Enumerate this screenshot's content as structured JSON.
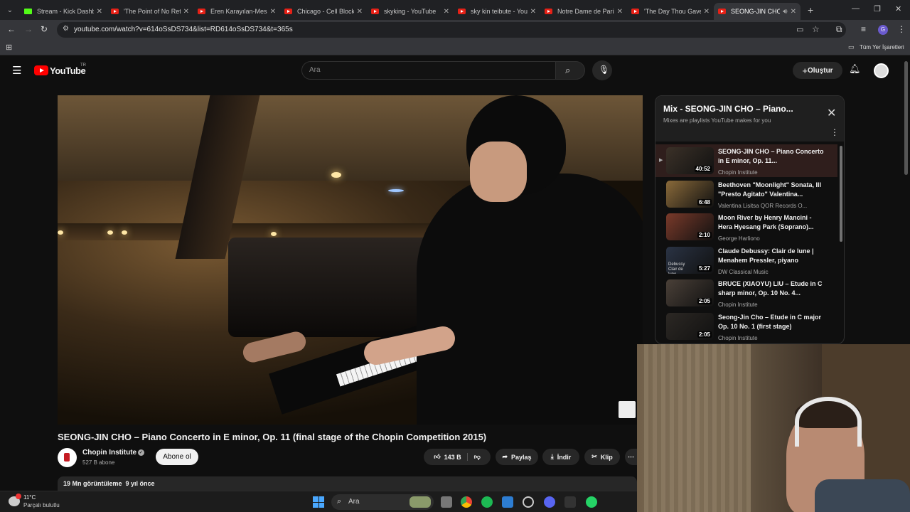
{
  "browser": {
    "tabs": [
      {
        "label": "Stream - Kick Dashboard",
        "kind": "kick"
      },
      {
        "label": "'The Point of No Return'",
        "kind": "yt"
      },
      {
        "label": "Eren Karayılan-Mesaj",
        "kind": "yt"
      },
      {
        "label": "Chicago - Cell Block Tango",
        "kind": "yt"
      },
      {
        "label": "skyking - YouTube",
        "kind": "yt"
      },
      {
        "label": "sky kin teibute - YouTube",
        "kind": "yt"
      },
      {
        "label": "Notre Dame de Paris",
        "kind": "yt"
      },
      {
        "label": "'The Day Thou Gavest'",
        "kind": "yt"
      },
      {
        "label": "SEONG-JIN CHO",
        "kind": "yt",
        "active": true
      }
    ],
    "url": "youtube.com/watch?v=614oSsDS734&list=RD614oSsDS734&t=365s",
    "bookmarks_folder": "Tüm Yer İşaretleri",
    "profile_initial": "G"
  },
  "youtube": {
    "logo_text": "YouTube",
    "region": "TR",
    "search_placeholder": "Ara",
    "create_label": "Oluştur"
  },
  "video": {
    "title": "SEONG-JIN CHO – Piano Concerto in E minor, Op. 11 (final stage of the Chopin Competition 2015)",
    "channel": "Chopin Institute",
    "subscribers": "527 B abone",
    "subscribe_label": "Abone ol",
    "likes": "143 B",
    "share_label": "Paylaş",
    "download_label": "İndir",
    "clip_label": "Klip",
    "views": "19 Mn görüntüleme",
    "uploaded": "9 yıl önce"
  },
  "mix": {
    "title": "Mix - SEONG-JIN CHO – Piano...",
    "subtitle": "Mixes are playlists YouTube makes for you",
    "items": [
      {
        "title": "SEONG-JIN CHO – Piano Concerto in E minor, Op. 11...",
        "channel": "Chopin Institute",
        "duration": "40:52",
        "current": true,
        "thumb": "#3b3128"
      },
      {
        "title": "Beethoven \"Moonlight\" Sonata, III \"Presto Agitato\" Valentina...",
        "channel": "Valentina Lisitsa QOR Records O...",
        "duration": "6:48",
        "thumb": "#8a6a3a"
      },
      {
        "title": "Moon River by Henry Mancini - Hera Hyesang Park (Soprano)...",
        "channel": "George Harliono",
        "duration": "2:10",
        "thumb": "#7a3a2a"
      },
      {
        "title": "Claude Debussy: Clair de lune | Menahem Pressler, piyano",
        "channel": "DW Classical Music",
        "duration": "5:27",
        "thumb": "#2a3344",
        "thumb_text": "Debussy Clair de lune"
      },
      {
        "title": "BRUCE (XIAOYU) LIU – Etude in C sharp minor, Op. 10 No. 4...",
        "channel": "Chopin Institute",
        "duration": "2:05",
        "thumb": "#4a4038"
      },
      {
        "title": "Seong-Jin Cho – Etude in C major Op. 10 No. 1 (first stage)",
        "channel": "Chopin Institute",
        "duration": "2:05",
        "thumb": "#2c2824"
      }
    ]
  },
  "taskbar": {
    "weather_temp": "11°C",
    "weather_desc": "Parçalı bulutlu",
    "search_label": "Ara"
  }
}
